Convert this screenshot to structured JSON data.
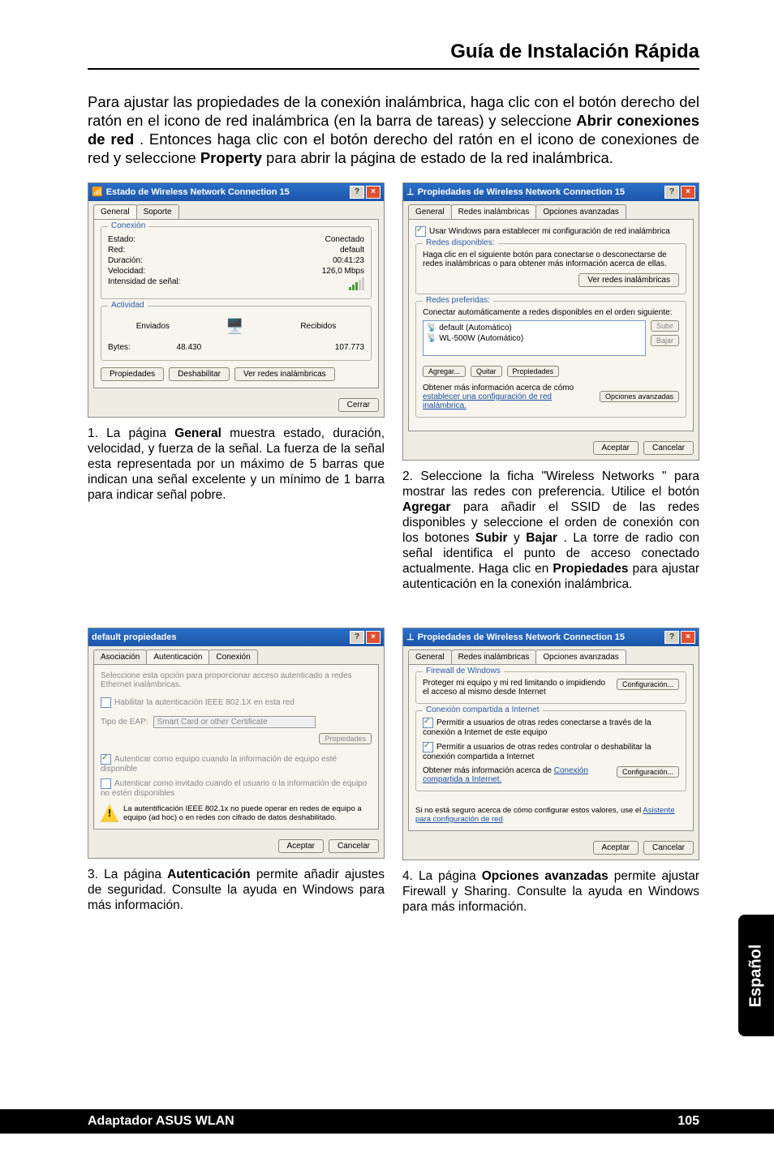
{
  "header": {
    "title": "Guía de Instalación Rápida"
  },
  "intro": {
    "pre": "Para ajustar las propiedades de la conexión inalámbrica, haga clic con el botón derecho del ratón en el icono de red inalámbrica (en la barra de tareas) y seleccione ",
    "b1": "Abrir conexiones de red",
    "mid": ". Entonces haga clic con el botón derecho del ratón en el icono de conexiones de red y seleccione ",
    "b2": "Property",
    "post": " para abrir la página de estado de la red inalámbrica."
  },
  "dlg1": {
    "title": "Estado de Wireless Network Connection 15",
    "tab_general": "General",
    "tab_soporte": "Soporte",
    "grp_conexion": "Conexión",
    "estado_k": "Estado:",
    "estado_v": "Conectado",
    "red_k": "Red:",
    "red_v": "default",
    "dur_k": "Duración:",
    "dur_v": "00:41:23",
    "vel_k": "Velocidad:",
    "vel_v": "126,0 Mbps",
    "int_k": "Intensidad de señal:",
    "grp_actividad": "Actividad",
    "enviados": "Enviados",
    "recibidos": "Recibidos",
    "bytes": "Bytes:",
    "bytes_env": "48.430",
    "bytes_rec": "107.773",
    "btn_prop": "Propiedades",
    "btn_desh": "Deshabilitar",
    "btn_ver": "Ver redes inalámbricas",
    "btn_cerrar": "Cerrar"
  },
  "cap1": {
    "n": "1. ",
    "pre": "La página ",
    "b": "General",
    "post": " muestra estado, duración, velocidad, y fuerza de la señal. La fuerza de la señal esta representada por un máximo de 5 barras que indican una señal excelente y un mínimo de 1 barra para indicar señal pobre."
  },
  "dlg2": {
    "title": "Propiedades de Wireless Network Connection 15",
    "tab_general": "General",
    "tab_redes": "Redes inalámbricas",
    "tab_opc": "Opciones avanzadas",
    "chk_usar": "Usar Windows para establecer mi configuración de red inalámbrica",
    "grp_disp": "Redes disponibles:",
    "disp_txt": "Haga clic en el siguiente botón para conectarse o desconectarse de redes inalámbricas o para obtener más información acerca de ellas.",
    "btn_ver": "Ver redes inalámbricas",
    "grp_pref": "Redes preferidas:",
    "pref_txt": "Conectar automáticamente a redes disponibles en el orden siguiente:",
    "item1": "default (Automático)",
    "item2": "WL-500W  (Automático)",
    "btn_subir": "Subir",
    "btn_bajar": "Bajar",
    "btn_agregar": "Agregar...",
    "btn_quitar": "Quitar",
    "btn_prop": "Propiedades",
    "info_txt": "Obtener más información acerca de cómo ",
    "info_link": "establecer una configuración de red inalámbrica.",
    "btn_opcav": "Opciones avanzadas",
    "btn_aceptar": "Aceptar",
    "btn_cancelar": "Cancelar"
  },
  "cap2": {
    "n": "2. ",
    "p1": "Seleccione la ficha \"Wireless Networks \" para mostrar las redes con preferencia. Utilice el botón ",
    "b1": "Agregar",
    "p2": " para añadir el SSID de las redes disponibles y seleccione el orden de conexión con los botones ",
    "b2": "Subir",
    "p3": " y ",
    "b3": "Bajar",
    "p4": ". La torre de radio con señal identifica el punto de acceso conectado actualmente. Haga clic en ",
    "b4": "Propiedades",
    "p5": " para ajustar autenticación en la conexión inalámbrica."
  },
  "dlg3": {
    "title": "default propiedades",
    "tab_asoc": "Asociación",
    "tab_aut": "Autenticación",
    "tab_con": "Conexión",
    "desc": "Seleccione esta opción para proporcionar acceso autenticado a redes Ethernet inalámbricas.",
    "chk_hab": "Habilitar la autenticación IEEE 802.1X en esta red",
    "tipo_lbl": "Tipo de EAP:",
    "tipo_val": "Smart Card or other Certificate",
    "btn_prop": "Propiedades",
    "chk_aut1": "Autenticar como equipo cuando la información de equipo esté disponible",
    "chk_aut2": "Autenticar como invitado cuando el usuario o la información de equipo no estén disponibles",
    "warn": "La autentificación IEEE 802.1x no puede operar en redes de equipo a equipo (ad hoc) o en redes con cifrado de datos deshabilitado.",
    "btn_aceptar": "Aceptar",
    "btn_cancelar": "Cancelar"
  },
  "cap3": {
    "n": "3. ",
    "pre": "La página ",
    "b": "Autenticación",
    "post": " permite añadir ajustes de seguridad. Consulte la ayuda en Windows para más información."
  },
  "dlg4": {
    "title": "Propiedades de Wireless Network Connection 15",
    "tab_general": "General",
    "tab_redes": "Redes inalámbricas",
    "tab_opc": "Opciones avanzadas",
    "grp_fw": "Firewall de Windows",
    "fw_txt": "Proteger mi equipo y mi red limitando o impidiendo el acceso al mismo desde Internet",
    "btn_conf1": "Configuración...",
    "grp_ics": "Conexión compartida a Internet",
    "chk_ics1": "Permitir a usuarios de otras redes conectarse a través de la conexión a Internet de este equipo",
    "chk_ics2": "Permitir a usuarios de otras redes controlar o deshabilitar la conexión compartida a Internet",
    "ics_txt": "Obtener más información acerca de ",
    "ics_link": "Conexión compartida a Internet.",
    "btn_conf2": "Configuración...",
    "help_txt": "Si no está seguro acerca de cómo configurar estos valores, use el ",
    "help_link": "Asistente para configuración de red",
    "btn_aceptar": "Aceptar",
    "btn_cancelar": "Cancelar"
  },
  "cap4": {
    "n": "4. ",
    "pre": "La página ",
    "b": "Opciones avanzadas",
    "post": " permite ajustar Firewall y Sharing. Consulte la ayuda en Windows para más información."
  },
  "side": {
    "label": "Español"
  },
  "footer": {
    "left": "Adaptador ASUS WLAN",
    "right": "105"
  }
}
